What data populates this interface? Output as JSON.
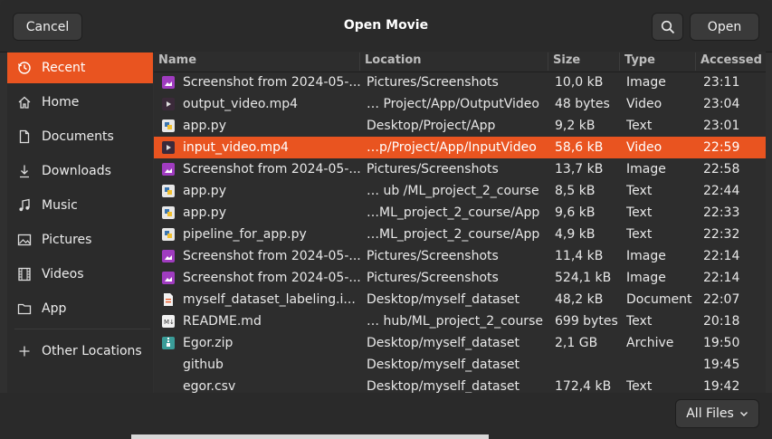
{
  "dialog": {
    "title": "Open Movie",
    "cancel_label": "Cancel",
    "open_label": "Open"
  },
  "sidebar": {
    "items": [
      {
        "label": "Recent",
        "icon": "clock-icon"
      },
      {
        "label": "Home",
        "icon": "home-icon"
      },
      {
        "label": "Documents",
        "icon": "document-icon"
      },
      {
        "label": "Downloads",
        "icon": "download-icon"
      },
      {
        "label": "Music",
        "icon": "music-icon"
      },
      {
        "label": "Pictures",
        "icon": "picture-icon"
      },
      {
        "label": "Videos",
        "icon": "film-icon"
      },
      {
        "label": "App",
        "icon": "folder-icon"
      }
    ],
    "other_locations_label": "Other Locations"
  },
  "columns": {
    "name": "Name",
    "location": "Location",
    "size": "Size",
    "type": "Type",
    "accessed": "Accessed"
  },
  "files": [
    {
      "name": "Screenshot from 2024-05-...",
      "location": "Pictures/Screenshots",
      "size": "10,0 kB",
      "type": "Image",
      "accessed": "23:11"
    },
    {
      "name": "output_video.mp4",
      "location": "… Project/App/OutputVideo",
      "size": "48 bytes",
      "type": "Video",
      "accessed": "23:04"
    },
    {
      "name": "app.py",
      "location": "Desktop/Project/App",
      "size": "9,2 kB",
      "type": "Text",
      "accessed": "23:01"
    },
    {
      "name": "input_video.mp4",
      "location": "…p/Project/App/InputVideo",
      "size": "58,6 kB",
      "type": "Video",
      "accessed": "22:59"
    },
    {
      "name": "Screenshot from 2024-05-...",
      "location": "Pictures/Screenshots",
      "size": "13,7 kB",
      "type": "Image",
      "accessed": "22:58"
    },
    {
      "name": "app.py",
      "location": "… ub /ML_project_2_course",
      "size": "8,5 kB",
      "type": "Text",
      "accessed": "22:44"
    },
    {
      "name": "app.py",
      "location": "…ML_project_2_course/App",
      "size": "9,6 kB",
      "type": "Text",
      "accessed": "22:33"
    },
    {
      "name": "pipeline_for_app.py",
      "location": "…ML_project_2_course/App",
      "size": "4,9 kB",
      "type": "Text",
      "accessed": "22:32"
    },
    {
      "name": "Screenshot from 2024-05-...",
      "location": "Pictures/Screenshots",
      "size": "11,4 kB",
      "type": "Image",
      "accessed": "22:14"
    },
    {
      "name": "Screenshot from 2024-05-...",
      "location": "Pictures/Screenshots",
      "size": "524,1 kB",
      "type": "Image",
      "accessed": "22:14"
    },
    {
      "name": "myself_dataset_labeling.i...",
      "location": "Desktop/myself_dataset",
      "size": "48,2 kB",
      "type": "Document",
      "accessed": "22:07"
    },
    {
      "name": "README.md",
      "location": "… hub/ML_project_2_course",
      "size": "699 bytes",
      "type": "Text",
      "accessed": "20:18"
    },
    {
      "name": "Egor.zip",
      "location": "Desktop/myself_dataset",
      "size": "2,1 GB",
      "type": "Archive",
      "accessed": "19:50"
    },
    {
      "name": "github",
      "location": "Desktop/myself_dataset",
      "size": "",
      "type": "",
      "accessed": "19:45"
    },
    {
      "name": "egor.csv",
      "location": "Desktop/myself_dataset",
      "size": "172,4 kB",
      "type": "Text",
      "accessed": "19:42"
    }
  ],
  "selected_index": 3,
  "filter": {
    "label": "All Files"
  },
  "colors": {
    "accent": "#e95420"
  }
}
